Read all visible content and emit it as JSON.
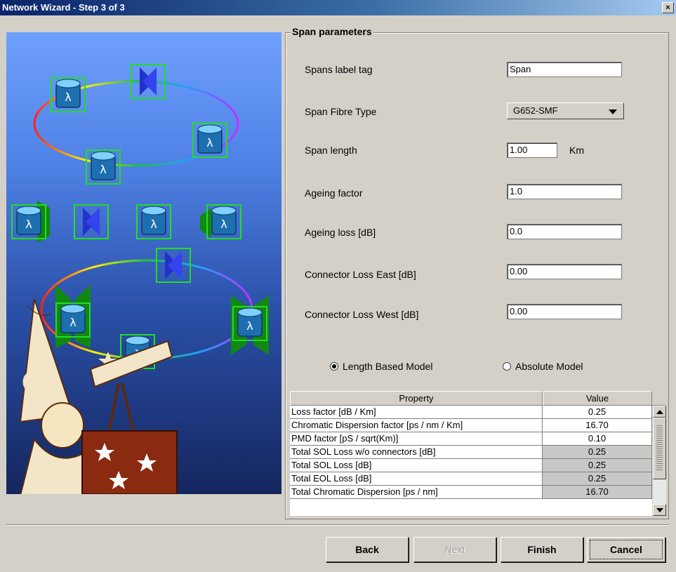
{
  "window": {
    "title": "Network Wizard - Step 3 of 3",
    "close_label": "×"
  },
  "group": {
    "title": "Span parameters"
  },
  "fields": [
    {
      "label": "Spans label tag",
      "value": "Span"
    },
    {
      "label": "Span Fibre Type",
      "value": "G652-SMF"
    },
    {
      "label": "Span length",
      "value": "1.00",
      "unit": "Km"
    },
    {
      "label": "Ageing factor",
      "value": "1.0"
    },
    {
      "label": "Ageing loss  [dB]",
      "value": "0.0"
    },
    {
      "label": "Connector Loss East [dB]",
      "value": "0.00"
    },
    {
      "label": "Connector Loss West [dB]",
      "value": "0.00"
    }
  ],
  "radios": [
    {
      "label": "Length Based Model",
      "selected": true
    },
    {
      "label": "Absolute Model",
      "selected": false
    }
  ],
  "table": {
    "headers": [
      "Property",
      "Value"
    ],
    "rows": [
      {
        "property": "Loss factor [dB / Km]",
        "value": "0.25",
        "editable": true
      },
      {
        "property": "Chromatic Dispersion factor [ps / nm / Km]",
        "value": "16.70",
        "editable": true
      },
      {
        "property": "PMD factor [pS / sqrt(Km)]",
        "value": "0.10",
        "editable": true
      },
      {
        "property": "Total SOL Loss w/o connectors [dB]",
        "value": "0.25",
        "editable": false
      },
      {
        "property": "Total SOL Loss [dB]",
        "value": "0.25",
        "editable": false
      },
      {
        "property": "Total EOL Loss [dB]",
        "value": "0.25",
        "editable": false
      },
      {
        "property": "Total Chromatic Dispersion [ps / nm]",
        "value": "16.70",
        "editable": false
      }
    ]
  },
  "buttons": {
    "back": "Back",
    "next": "Next",
    "finish": "Finish",
    "cancel": "Cancel"
  },
  "illustration": {
    "lambda": "λ"
  }
}
